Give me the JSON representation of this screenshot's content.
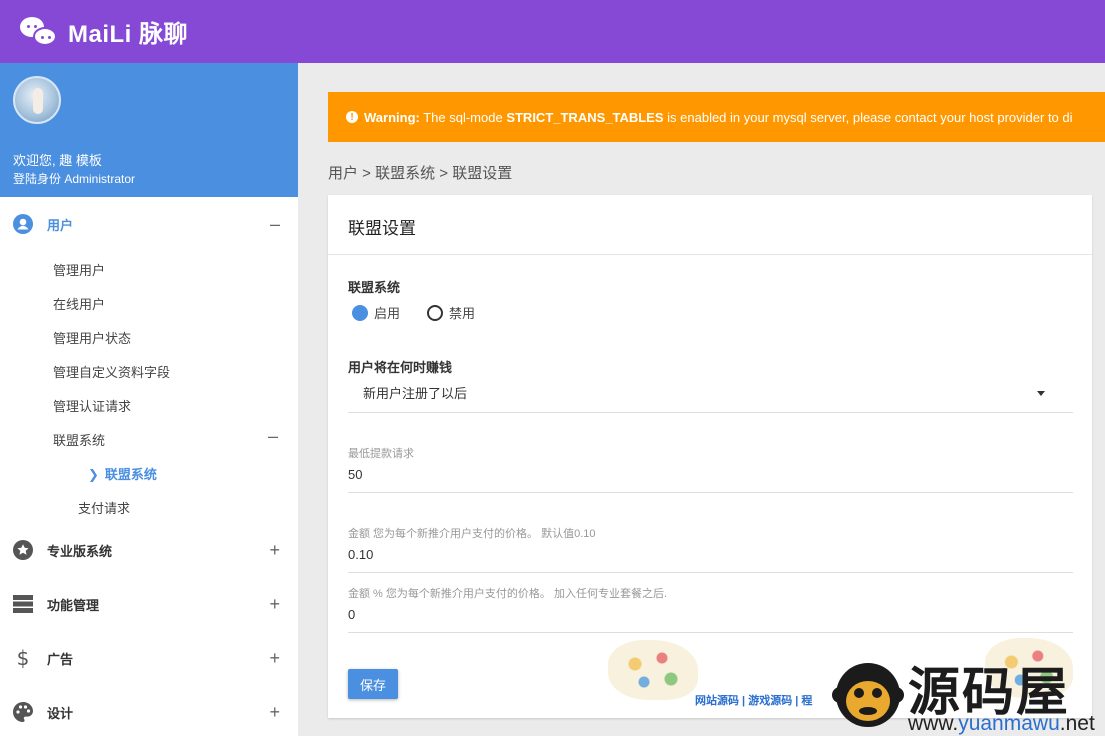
{
  "app": {
    "title": "MaiLi 脉聊"
  },
  "profile": {
    "welcome": "欢迎您, 趣 模板",
    "role": "登陆身份 Administrator"
  },
  "sidebar": {
    "users": {
      "label": "用户",
      "toggle": "–"
    },
    "user_items": [
      "管理用户",
      "在线用户",
      "管理用户状态",
      "管理自定义资料字段",
      "管理认证请求"
    ],
    "affiliate_group": {
      "label": "联盟系统",
      "toggle": "–"
    },
    "affiliate_current": "联盟系统",
    "payment_requests": "支付请求",
    "pro": {
      "label": "专业版系统",
      "toggle": "+"
    },
    "features": {
      "label": "功能管理",
      "toggle": "+"
    },
    "ads": {
      "label": "广告",
      "toggle": "+"
    },
    "design": {
      "label": "设计",
      "toggle": "+"
    }
  },
  "warning": {
    "prefix": "Warning:",
    "text1": " The sql-mode ",
    "code": "STRICT_TRANS_TABLES",
    "text2": " is enabled in your mysql server, please contact your host provider to di"
  },
  "breadcrumb": "用户 > 联盟系统 > 联盟设置",
  "card": {
    "title": "联盟设置",
    "affiliate_label": "联盟系统",
    "radio_on": "启用",
    "radio_off": "禁用",
    "earn_label": "用户将在何时赚钱",
    "earn_value": "新用户注册了以后",
    "min_withdraw_label": "最低提款请求",
    "min_withdraw_value": "50",
    "amount_label": "金额 您为每个新推介用户支付的价格。 默认值0.10",
    "amount_value": "0.10",
    "amount_pct_label": "金额 % 您为每个新推介用户支付的价格。 加入任何专业套餐之后.",
    "amount_pct_value": "0",
    "save": "保存"
  },
  "watermark": {
    "links": "网站源码 | 游戏源码 | 程",
    "brand": "源码屋",
    "url_prefix": "www.",
    "url_domain": "yuanmawu",
    "url_suffix": ".net"
  },
  "colors": {
    "topbar": "#8549d6",
    "accent": "#4a8fe0",
    "warning": "#ff9800"
  }
}
